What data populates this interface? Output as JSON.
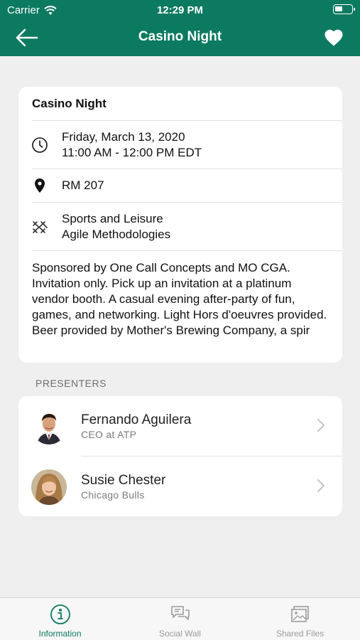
{
  "status_bar": {
    "carrier": "Carrier",
    "time": "12:29 PM"
  },
  "nav": {
    "title": "Casino Night",
    "back_icon": "arrow-left-icon",
    "favorite_icon": "heart-icon"
  },
  "event": {
    "title": "Casino Night",
    "date": "Friday, March 13, 2020",
    "time": "11:00 AM - 12:00 PM EDT",
    "location": "RM 207",
    "tracks": [
      "Sports and Leisure",
      "Agile Methodologies"
    ],
    "description": "Sponsored by One Call Concepts and MO CGA. Invitation only. Pick up an invitation at a platinum vendor booth. A casual evening after-party of fun, games, and networking. Light Hors d'oeuvres provided. Beer provided by Mother's Brewing Company, a spir"
  },
  "presenters": {
    "section_label": "PRESENTERS",
    "items": [
      {
        "name": "Fernando Aguilera",
        "subtitle": "CEO at ATP"
      },
      {
        "name": "Susie Chester",
        "subtitle": "Chicago Bulls"
      }
    ]
  },
  "tabs": [
    {
      "label": "Information",
      "icon": "info-icon",
      "active": true
    },
    {
      "label": "Social Wall",
      "icon": "chat-bubbles-icon",
      "active": false
    },
    {
      "label": "Shared Files",
      "icon": "image-files-icon",
      "active": false
    }
  ],
  "colors": {
    "brand": "#0c7a60",
    "background": "#efefef",
    "card": "#ffffff",
    "inactive_tab": "#9b9b9b"
  }
}
